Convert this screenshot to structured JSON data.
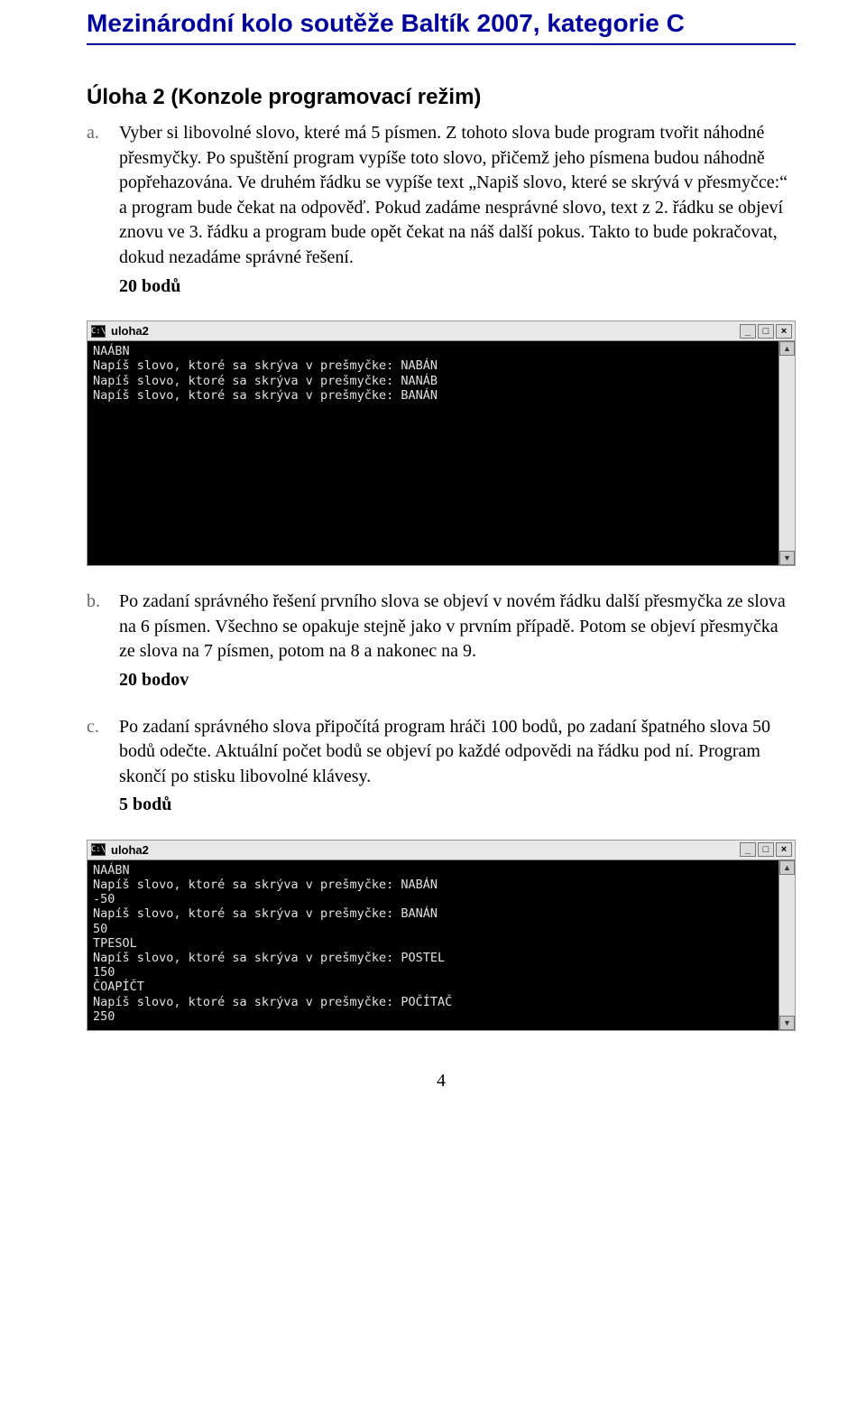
{
  "header": {
    "title": "Mezinárodní kolo soutěže Baltík 2007, kategorie C"
  },
  "task": {
    "title": "Úloha 2 (Konzole programovací režim)"
  },
  "items": {
    "a": {
      "letter": "a.",
      "text": "Vyber si libovolné slovo, které má 5 písmen. Z tohoto slova bude program tvořit náhodné přesmyčky. Po spuštění program vypíše toto slovo, přičemž jeho písmena budou náhodně popřehazována. Ve druhém řádku se vypíše text „Napiš slovo, které se skrývá v přesmyčce:“ a program bude čekat na odpověď. Pokud zadáme nesprávné slovo, text z 2. řádku se objeví znovu ve 3. řádku a program bude opět čekat na náš další pokus. Takto to bude pokračovat, dokud nezadáme správné řešení.",
      "points": "20 bodů"
    },
    "b": {
      "letter": "b.",
      "text": "Po zadaní správného řešení prvního slova se objeví v novém řádku další přesmyčka ze slova na 6 písmen. Všechno se opakuje stejně jako v prvním případě. Potom se objeví přesmyčka ze slova na 7 písmen, potom na 8 a nakonec na 9.",
      "points": "20 bodov"
    },
    "c": {
      "letter": "c.",
      "text": "Po zadaní správného slova připočítá program hráči 100 bodů, po zadaní špatného slova 50 bodů odečte. Aktuální počet bodů se objeví po každé odpovědi na řádku pod ní. Program skončí po stisku libovolné klávesy.",
      "points": "5 bodů"
    }
  },
  "console1": {
    "icon": "C:\\",
    "title": "uloha2",
    "lines": "NAÁBN\nNapíš slovo, ktoré sa skrýva v prešmyčke: NABÁN\nNapíš slovo, ktoré sa skrýva v prešmyčke: NANÁB\nNapíš slovo, ktoré sa skrýva v prešmyčke: BANÁN"
  },
  "console2": {
    "icon": "C:\\",
    "title": "uloha2",
    "lines": "NAÁBN\nNapíš slovo, ktoré sa skrýva v prešmyčke: NABÁN\n-50\nNapíš slovo, ktoré sa skrýva v prešmyčke: BANÁN\n50\nTPESOL\nNapíš slovo, ktoré sa skrýva v prešmyčke: POSTEL\n150\nČOAPÍČT\nNapíš slovo, ktoré sa skrýva v prešmyčke: POČÍTAČ\n250"
  },
  "buttons": {
    "min": "_",
    "max": "□",
    "close": "×",
    "up": "▲",
    "down": "▼"
  },
  "pageNumber": "4"
}
